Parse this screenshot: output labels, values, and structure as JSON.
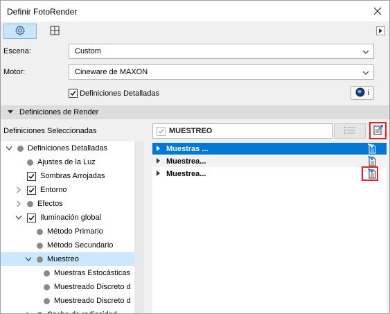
{
  "window": {
    "title": "Definir FotoRender"
  },
  "toolbar": {
    "tabs": [
      {
        "icon": "gear-icon",
        "active": true
      },
      {
        "icon": "viewport-icon",
        "active": false
      }
    ],
    "scroll_icon": "arrow-right-icon"
  },
  "form": {
    "scene_label": "Escena:",
    "scene_value": "Custom",
    "engine_label": "Motor:",
    "engine_value": "Cineware de MAXON",
    "detailed_checkbox_label": "Definiciones Detalladas",
    "detailed_checked": true,
    "info_button_label": "i"
  },
  "section": {
    "title": "Definiciones de Render"
  },
  "selected_label": "Definiciones Seleccionadas",
  "tree": {
    "items": [
      {
        "label": "Definiciones Detalladas",
        "level": 0,
        "toggle": "expanded",
        "marker": "dot"
      },
      {
        "label": "Ajustes de la Luz",
        "level": 1,
        "toggle": "none",
        "marker": "dot"
      },
      {
        "label": "Sombras Arrojadas",
        "level": 1,
        "toggle": "none",
        "marker": "check"
      },
      {
        "label": "Entorno",
        "level": 1,
        "toggle": "collapsed",
        "marker": "check"
      },
      {
        "label": "Efectos",
        "level": 1,
        "toggle": "collapsed",
        "marker": "dot"
      },
      {
        "label": "Iluminación global",
        "level": 1,
        "toggle": "expanded",
        "marker": "check"
      },
      {
        "label": "Método Primario",
        "level": 2,
        "toggle": "none",
        "marker": "dot"
      },
      {
        "label": "Método Secundario",
        "level": 2,
        "toggle": "none",
        "marker": "dot"
      },
      {
        "label": "Muestreo",
        "level": 2,
        "toggle": "expanded",
        "marker": "dot",
        "selected": true
      },
      {
        "label": "Muestras Estocásticas",
        "level": 3,
        "toggle": "none",
        "marker": "dot"
      },
      {
        "label": "Muestreado Discreto d",
        "level": 3,
        "toggle": "none",
        "marker": "dot"
      },
      {
        "label": "Muestreado Discreto d",
        "level": 3,
        "toggle": "none",
        "marker": "dot"
      },
      {
        "label": "Cache de radiosidad",
        "level": 2,
        "toggle": "collapsed",
        "marker": "dot"
      }
    ]
  },
  "preset": {
    "name": "MUESTREO",
    "checked": true
  },
  "right_list": {
    "rows": [
      {
        "label": "Muestras ...",
        "selected": true
      },
      {
        "label": "Muestrea...",
        "selected": false
      },
      {
        "label": "Muestrea...",
        "selected": false,
        "highlighted": true
      }
    ]
  },
  "colors": {
    "selection_blue": "#0078d7",
    "tree_selection": "#cce8ff",
    "highlight_red": "#e81e25",
    "section_bg": "#dcdcdc"
  }
}
